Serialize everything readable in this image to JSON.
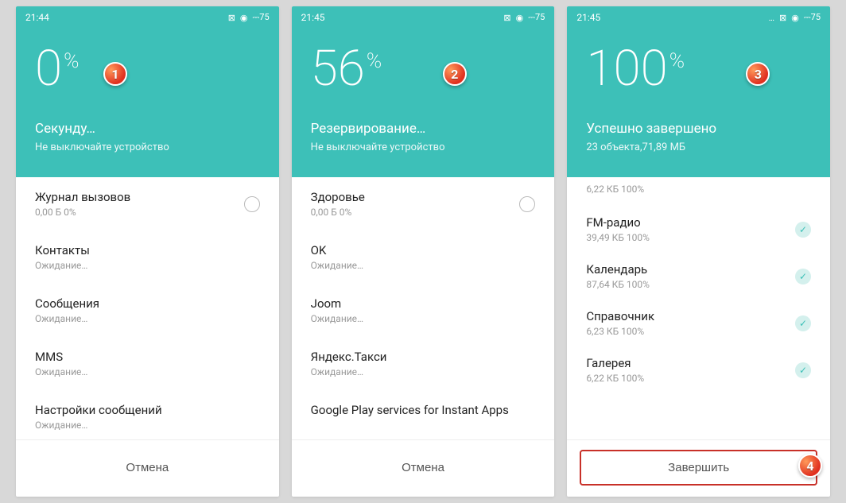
{
  "screens": [
    {
      "time": "21:44",
      "battery": "75",
      "percent": "0",
      "title": "Секунду…",
      "subtitle": "Не выключайте устройство",
      "items": [
        {
          "title": "Журнал вызовов",
          "sub": "0,00 Б 0%",
          "status": "radio"
        },
        {
          "title": "Контакты",
          "sub": "Ожидание…",
          "status": "none"
        },
        {
          "title": "Сообщения",
          "sub": "Ожидание…",
          "status": "none"
        },
        {
          "title": "MMS",
          "sub": "Ожидание…",
          "status": "none"
        },
        {
          "title": "Настройки сообщений",
          "sub": "Ожидание…",
          "status": "none"
        }
      ],
      "button": "Отмена",
      "badge": "1"
    },
    {
      "time": "21:45",
      "battery": "75",
      "percent": "56",
      "title": "Резервирование…",
      "subtitle": "Не выключайте устройство",
      "items": [
        {
          "title": "Здоровье",
          "sub": "0,00 Б 0%",
          "status": "radio"
        },
        {
          "title": "OK",
          "sub": "Ожидание…",
          "status": "none"
        },
        {
          "title": "Joom",
          "sub": "Ожидание…",
          "status": "none"
        },
        {
          "title": "Яндекс.Такси",
          "sub": "Ожидание…",
          "status": "none"
        },
        {
          "title": "Google Play services for Instant Apps",
          "sub": "",
          "status": "none"
        }
      ],
      "button": "Отмена",
      "badge": "2"
    },
    {
      "time": "21:45",
      "battery": "75",
      "percent": "100",
      "title": "Успешно завершено",
      "subtitle": "23 объекта,71,89 МБ",
      "subOnly": "6,22 КБ 100%",
      "items": [
        {
          "title": "FM-радио",
          "sub": "39,49 КБ 100%",
          "status": "check"
        },
        {
          "title": "Календарь",
          "sub": "87,64 КБ 100%",
          "status": "check"
        },
        {
          "title": "Справочник",
          "sub": "6,23 КБ 100%",
          "status": "check"
        },
        {
          "title": "Галерея",
          "sub": "6,22 КБ 100%",
          "status": "check"
        }
      ],
      "button": "Завершить",
      "badge": "3",
      "footerBadge": "4",
      "buttonHighlight": true
    }
  ]
}
